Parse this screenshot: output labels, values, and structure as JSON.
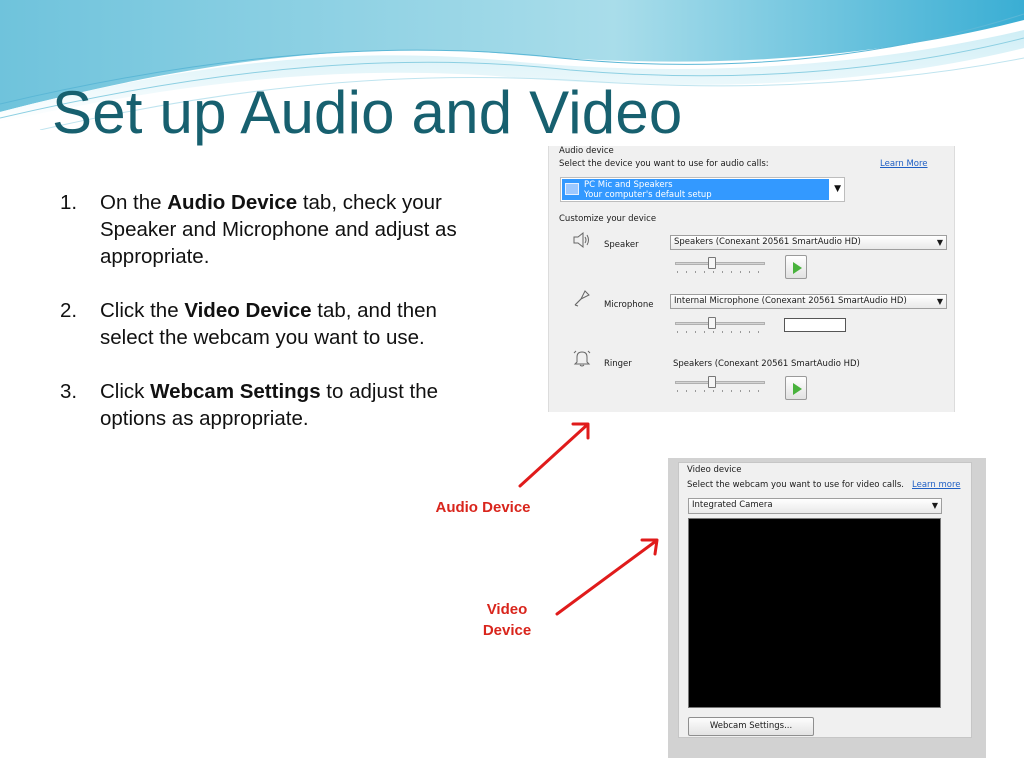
{
  "slide": {
    "title": "Set up Audio and Video",
    "steps": [
      {
        "number": "1.",
        "before": "On the ",
        "bold": "Audio Device",
        "after": " tab, check your Speaker and Microphone and adjust as appropriate."
      },
      {
        "number": "2.",
        "before": "Click the ",
        "bold": "Video Device",
        "after": " tab, and then select the webcam you want to use."
      },
      {
        "number": "3.",
        "before": "Click ",
        "bold": "Webcam Settings",
        "after": " to adjust the options as appropriate."
      }
    ],
    "callouts": {
      "audio": "Audio Device",
      "video_line1": "Video",
      "video_line2": "Device"
    },
    "colors": {
      "title": "#17606f",
      "callout": "#d9251c",
      "arrow": "#e01b1b",
      "selection": "#3399ff",
      "link": "#1f5fc4"
    }
  },
  "audio_panel": {
    "group_label": "Audio device",
    "prompt": "Select the device you want to use for audio calls:",
    "learn_more": "Learn More",
    "selected_device": {
      "name": "PC Mic and Speakers",
      "description": "Your computer's default setup",
      "icon": "speaker-device-icon"
    },
    "customize_label": "Customize your device",
    "speaker": {
      "label": "Speaker",
      "device": "Speakers (Conexant 20561 SmartAudio HD)",
      "volume": 0.4,
      "icon": "speaker-icon"
    },
    "microphone": {
      "label": "Microphone",
      "device": "Internal Microphone (Conexant 20561 SmartAudio HD)",
      "volume": 0.4,
      "icon": "microphone-icon"
    },
    "ringer": {
      "label": "Ringer",
      "device": "Speakers (Conexant 20561 SmartAudio HD)",
      "volume": 0.4,
      "icon": "bell-icon"
    }
  },
  "video_panel": {
    "group_label": "Video device",
    "prompt": "Select the webcam you want to use for video calls.",
    "learn_more": "Learn more",
    "selected_camera": "Integrated Camera",
    "settings_button": "Webcam Settings..."
  }
}
